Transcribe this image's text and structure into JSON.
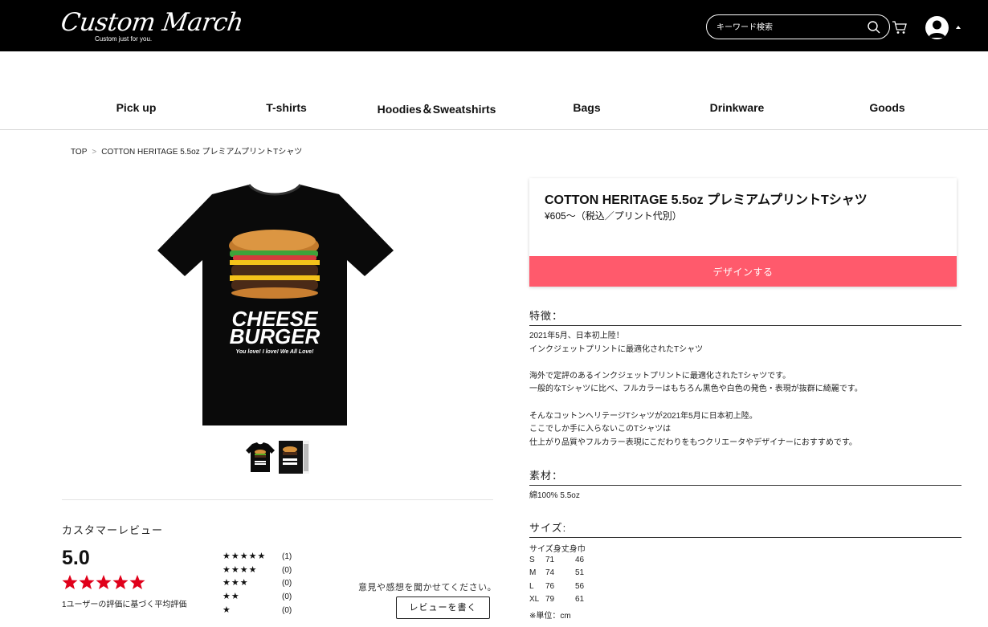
{
  "header": {
    "logo_text": "Custom March",
    "logo_tagline": "Custom just for you.",
    "search_placeholder": "キーワード検索"
  },
  "nav": {
    "items": [
      "Pick up",
      "T-shirts",
      "Hoodies＆Sweatshirts",
      "Bags",
      "Drinkware",
      "Goods"
    ]
  },
  "breadcrumb": {
    "home": "TOP",
    "separator": ">",
    "current": "COTTON HERITAGE 5.5oz プレミアムプリントTシャツ"
  },
  "product": {
    "image_text": {
      "line1": "CHEESE",
      "line2": "BURGER",
      "tagline": "You love! I love! We All Love!"
    },
    "title": "COTTON HERITAGE 5.5oz プレミアムプリントTシャツ",
    "price": "¥605～（税込／プリント代別）",
    "design_button": "デザインする"
  },
  "features": {
    "heading": "特徴：",
    "lines": [
      "2021年5月、日本初上陸！",
      "インクジェットプリントに最適化されたTシャツ",
      "",
      "海外で定評のあるインクジェットプリントに最適化されたTシャツです。",
      "一般的なTシャツに比べ、フルカラーはもちろん黒色や白色の発色・表現が抜群に綺麗です。",
      "",
      "そんなコットンヘリテージTシャツが2021年5月に日本初上陸。",
      "ここでしか手に入らないこのTシャツは",
      "仕上がり品質やフルカラー表現にこだわりをもつクリエータやデザイナーにおすすめです。"
    ]
  },
  "material": {
    "heading": "素材：",
    "text": "綿100% 5.5oz"
  },
  "size": {
    "heading": "サイズ:",
    "header_row": "サイズ身丈身巾",
    "rows": [
      {
        "size": "S",
        "length": "71",
        "width": "46"
      },
      {
        "size": "M",
        "length": "74",
        "width": "51"
      },
      {
        "size": "L",
        "length": "76",
        "width": "56"
      },
      {
        "size": "XL",
        "length": "79",
        "width": "61"
      }
    ],
    "unit_note": "※単位：cm"
  },
  "reviews": {
    "heading": "カスタマーレビュー",
    "average": "5.0",
    "stars_filled": 5,
    "note": "1ユーザーの評価に基づく平均評価",
    "distribution": [
      {
        "stars": "★★★★★",
        "count": "(1)"
      },
      {
        "stars": "★★★★",
        "count": "(0)"
      },
      {
        "stars": "★★★",
        "count": "(0)"
      },
      {
        "stars": "★★",
        "count": "(0)"
      },
      {
        "stars": "★",
        "count": "(0)"
      }
    ],
    "prompt": "意見や感想を聞かせてください。",
    "write_button": "レビューを書く"
  },
  "colors": {
    "accent": "#ff5a6c",
    "star_red": "#e0001a",
    "header_bg": "#000000"
  }
}
